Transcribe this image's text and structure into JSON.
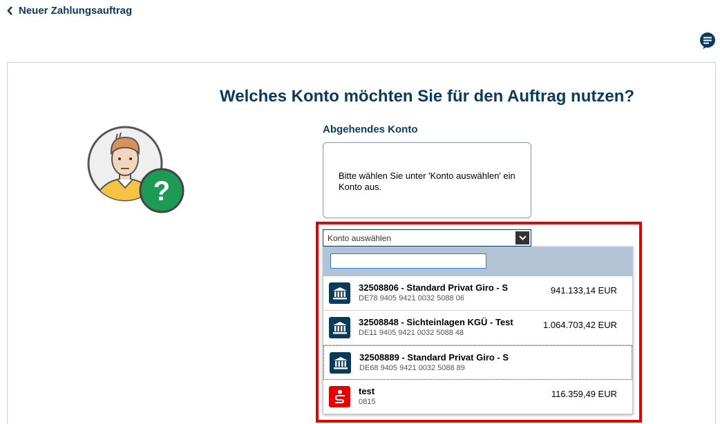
{
  "header": {
    "back_label": "Neuer Zahlungsauftrag"
  },
  "main": {
    "question": "Welches Konto möchten Sie für den Auftrag nutzen?",
    "section_label": "Abgehendes Konto",
    "info_text": "Bitte wählen Sie unter 'Konto auswählen' ein Konto aus."
  },
  "select": {
    "placeholder": "Konto auswählen",
    "search_value": ""
  },
  "accounts": [
    {
      "name": "32508806 - Standard Privat Giro - S",
      "iban": "DE78 9405 9421 0032 5088 06",
      "amount": "941.133,14 EUR",
      "icon": "bank-icon"
    },
    {
      "name": "32508848 - Sichteinlagen KGÜ - Test",
      "iban": "DE11 9405 9421 0032 5088 48",
      "amount": "1.064.703,42 EUR",
      "icon": "bank-icon"
    },
    {
      "name": "32508889 - Standard Privat Giro - S",
      "iban": "DE68 9405 9421 0032 5088 89",
      "amount": "",
      "icon": "bank-icon"
    },
    {
      "name": "test",
      "iban": "0815",
      "amount": "116.359,49 EUR",
      "icon": "sparkasse-icon"
    }
  ],
  "colors": {
    "brand_dark": "#0a3a5c",
    "highlight": "#e20000",
    "sparkasse_red": "#e60000",
    "question_green": "#1e9a57"
  }
}
